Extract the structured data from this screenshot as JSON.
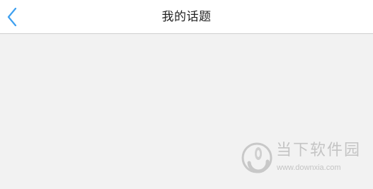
{
  "header": {
    "title": "我的话题",
    "back_icon": "chevron-left-icon",
    "accent_color": "#3ea0f0"
  },
  "content": {
    "background_color": "#f2f2f2"
  },
  "watermark": {
    "name": "当下软件园",
    "url": "www.downxia.com",
    "logo_icon": "downxia-logo-icon"
  }
}
